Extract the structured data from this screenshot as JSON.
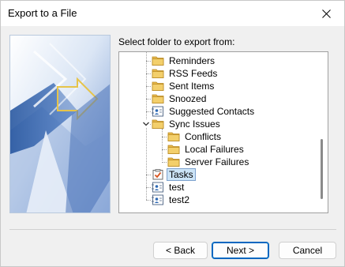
{
  "window": {
    "title": "Export to a File"
  },
  "prompt": "Select folder to export from:",
  "tree": {
    "items": [
      {
        "label": "Reminders",
        "icon": "folder-icon"
      },
      {
        "label": "RSS Feeds",
        "icon": "folder-icon"
      },
      {
        "label": "Sent Items",
        "icon": "folder-icon"
      },
      {
        "label": "Snoozed",
        "icon": "folder-icon"
      },
      {
        "label": "Suggested Contacts",
        "icon": "contacts-icon"
      },
      {
        "label": "Sync Issues",
        "icon": "folder-icon",
        "expanded": true
      },
      {
        "label": "Conflicts",
        "icon": "folder-icon"
      },
      {
        "label": "Local Failures",
        "icon": "folder-icon"
      },
      {
        "label": "Server Failures",
        "icon": "folder-icon"
      },
      {
        "label": "Tasks",
        "icon": "tasks-icon",
        "selected": true
      },
      {
        "label": "test",
        "icon": "contacts-icon"
      },
      {
        "label": "test2",
        "icon": "contacts-icon"
      }
    ]
  },
  "buttons": {
    "back": "< Back",
    "next": "Next >",
    "cancel": "Cancel"
  },
  "colors": {
    "selection": "#cce4f7",
    "default_button_border": "#0067c0",
    "folder": "#e8b84a"
  }
}
